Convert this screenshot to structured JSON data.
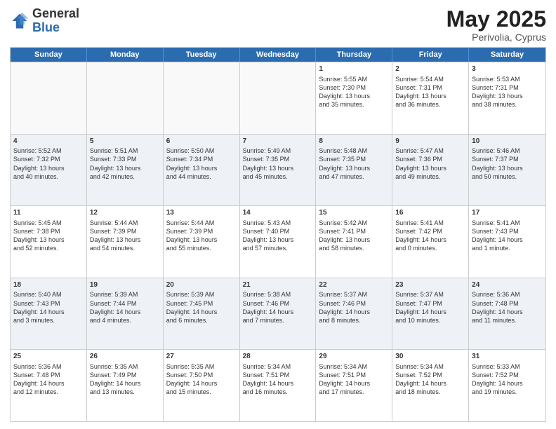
{
  "logo": {
    "general": "General",
    "blue": "Blue"
  },
  "title": {
    "month": "May 2025",
    "location": "Perivolia, Cyprus"
  },
  "weekdays": [
    "Sunday",
    "Monday",
    "Tuesday",
    "Wednesday",
    "Thursday",
    "Friday",
    "Saturday"
  ],
  "rows": [
    [
      {
        "day": "",
        "content": ""
      },
      {
        "day": "",
        "content": ""
      },
      {
        "day": "",
        "content": ""
      },
      {
        "day": "",
        "content": ""
      },
      {
        "day": "1",
        "content": "Sunrise: 5:55 AM\nSunset: 7:30 PM\nDaylight: 13 hours\nand 35 minutes."
      },
      {
        "day": "2",
        "content": "Sunrise: 5:54 AM\nSunset: 7:31 PM\nDaylight: 13 hours\nand 36 minutes."
      },
      {
        "day": "3",
        "content": "Sunrise: 5:53 AM\nSunset: 7:31 PM\nDaylight: 13 hours\nand 38 minutes."
      }
    ],
    [
      {
        "day": "4",
        "content": "Sunrise: 5:52 AM\nSunset: 7:32 PM\nDaylight: 13 hours\nand 40 minutes."
      },
      {
        "day": "5",
        "content": "Sunrise: 5:51 AM\nSunset: 7:33 PM\nDaylight: 13 hours\nand 42 minutes."
      },
      {
        "day": "6",
        "content": "Sunrise: 5:50 AM\nSunset: 7:34 PM\nDaylight: 13 hours\nand 44 minutes."
      },
      {
        "day": "7",
        "content": "Sunrise: 5:49 AM\nSunset: 7:35 PM\nDaylight: 13 hours\nand 45 minutes."
      },
      {
        "day": "8",
        "content": "Sunrise: 5:48 AM\nSunset: 7:35 PM\nDaylight: 13 hours\nand 47 minutes."
      },
      {
        "day": "9",
        "content": "Sunrise: 5:47 AM\nSunset: 7:36 PM\nDaylight: 13 hours\nand 49 minutes."
      },
      {
        "day": "10",
        "content": "Sunrise: 5:46 AM\nSunset: 7:37 PM\nDaylight: 13 hours\nand 50 minutes."
      }
    ],
    [
      {
        "day": "11",
        "content": "Sunrise: 5:45 AM\nSunset: 7:38 PM\nDaylight: 13 hours\nand 52 minutes."
      },
      {
        "day": "12",
        "content": "Sunrise: 5:44 AM\nSunset: 7:39 PM\nDaylight: 13 hours\nand 54 minutes."
      },
      {
        "day": "13",
        "content": "Sunrise: 5:44 AM\nSunset: 7:39 PM\nDaylight: 13 hours\nand 55 minutes."
      },
      {
        "day": "14",
        "content": "Sunrise: 5:43 AM\nSunset: 7:40 PM\nDaylight: 13 hours\nand 57 minutes."
      },
      {
        "day": "15",
        "content": "Sunrise: 5:42 AM\nSunset: 7:41 PM\nDaylight: 13 hours\nand 58 minutes."
      },
      {
        "day": "16",
        "content": "Sunrise: 5:41 AM\nSunset: 7:42 PM\nDaylight: 14 hours\nand 0 minutes."
      },
      {
        "day": "17",
        "content": "Sunrise: 5:41 AM\nSunset: 7:43 PM\nDaylight: 14 hours\nand 1 minute."
      }
    ],
    [
      {
        "day": "18",
        "content": "Sunrise: 5:40 AM\nSunset: 7:43 PM\nDaylight: 14 hours\nand 3 minutes."
      },
      {
        "day": "19",
        "content": "Sunrise: 5:39 AM\nSunset: 7:44 PM\nDaylight: 14 hours\nand 4 minutes."
      },
      {
        "day": "20",
        "content": "Sunrise: 5:39 AM\nSunset: 7:45 PM\nDaylight: 14 hours\nand 6 minutes."
      },
      {
        "day": "21",
        "content": "Sunrise: 5:38 AM\nSunset: 7:46 PM\nDaylight: 14 hours\nand 7 minutes."
      },
      {
        "day": "22",
        "content": "Sunrise: 5:37 AM\nSunset: 7:46 PM\nDaylight: 14 hours\nand 8 minutes."
      },
      {
        "day": "23",
        "content": "Sunrise: 5:37 AM\nSunset: 7:47 PM\nDaylight: 14 hours\nand 10 minutes."
      },
      {
        "day": "24",
        "content": "Sunrise: 5:36 AM\nSunset: 7:48 PM\nDaylight: 14 hours\nand 11 minutes."
      }
    ],
    [
      {
        "day": "25",
        "content": "Sunrise: 5:36 AM\nSunset: 7:48 PM\nDaylight: 14 hours\nand 12 minutes."
      },
      {
        "day": "26",
        "content": "Sunrise: 5:35 AM\nSunset: 7:49 PM\nDaylight: 14 hours\nand 13 minutes."
      },
      {
        "day": "27",
        "content": "Sunrise: 5:35 AM\nSunset: 7:50 PM\nDaylight: 14 hours\nand 15 minutes."
      },
      {
        "day": "28",
        "content": "Sunrise: 5:34 AM\nSunset: 7:51 PM\nDaylight: 14 hours\nand 16 minutes."
      },
      {
        "day": "29",
        "content": "Sunrise: 5:34 AM\nSunset: 7:51 PM\nDaylight: 14 hours\nand 17 minutes."
      },
      {
        "day": "30",
        "content": "Sunrise: 5:34 AM\nSunset: 7:52 PM\nDaylight: 14 hours\nand 18 minutes."
      },
      {
        "day": "31",
        "content": "Sunrise: 5:33 AM\nSunset: 7:52 PM\nDaylight: 14 hours\nand 19 minutes."
      }
    ]
  ]
}
